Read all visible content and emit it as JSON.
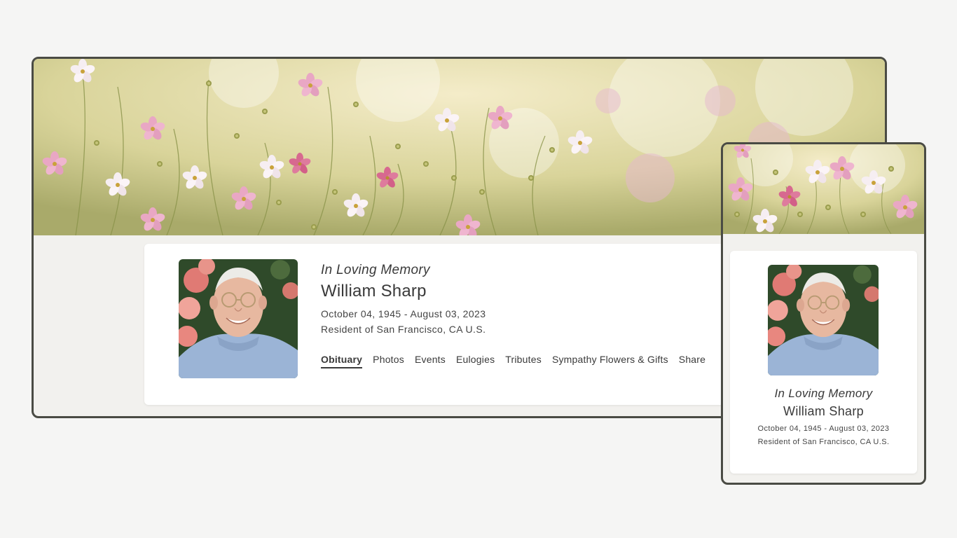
{
  "profile": {
    "tagline": "In Loving Memory",
    "name": "William Sharp",
    "dates": "October 04, 1945 - August 03, 2023",
    "resident": "Resident of San Francisco, CA U.S."
  },
  "nav": {
    "tabs": [
      {
        "label": "Obituary",
        "active": true
      },
      {
        "label": "Photos"
      },
      {
        "label": "Events"
      },
      {
        "label": "Eulogies"
      },
      {
        "label": "Tributes"
      },
      {
        "label": "Sympathy Flowers & Gifts"
      },
      {
        "label": "Share"
      }
    ]
  },
  "colors": {
    "frame": "#4a4b44",
    "background": "#f5f5f4",
    "panel": "#f2f1ee",
    "card": "#ffffff"
  },
  "images": {
    "hero": "flower-field-banner",
    "portrait": "elderly-man-portrait"
  }
}
